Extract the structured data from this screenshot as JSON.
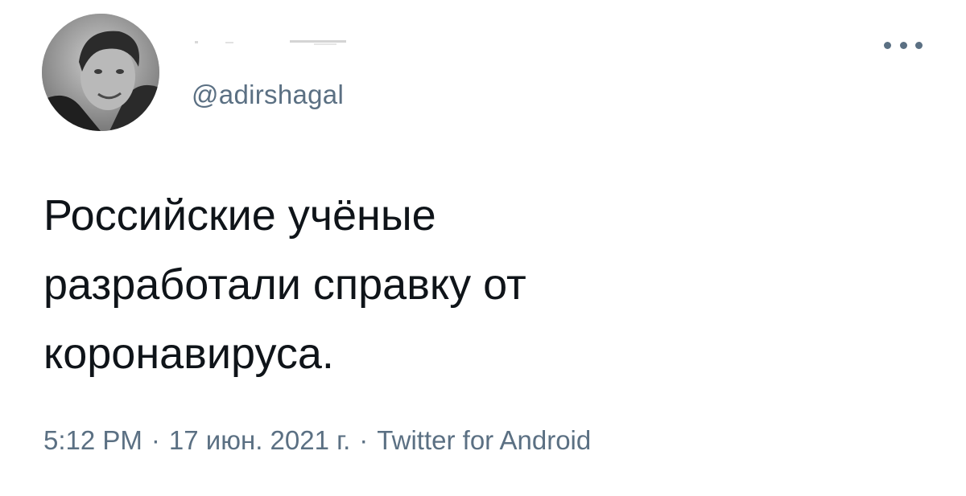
{
  "author": {
    "handle": "@adirshagal"
  },
  "tweet": {
    "text_lines": [
      "Российские учёные",
      "разработали справку от",
      "коронавируса."
    ]
  },
  "meta": {
    "time": "5:12 PM",
    "separator": "·",
    "date": "17 июн. 2021 г.",
    "source": "Twitter for Android"
  },
  "icons": {
    "avatar": "avatar-photo",
    "more": "more-options-icon"
  },
  "colors": {
    "text": "#0f1419",
    "secondary": "#5b7083",
    "background": "#ffffff"
  }
}
